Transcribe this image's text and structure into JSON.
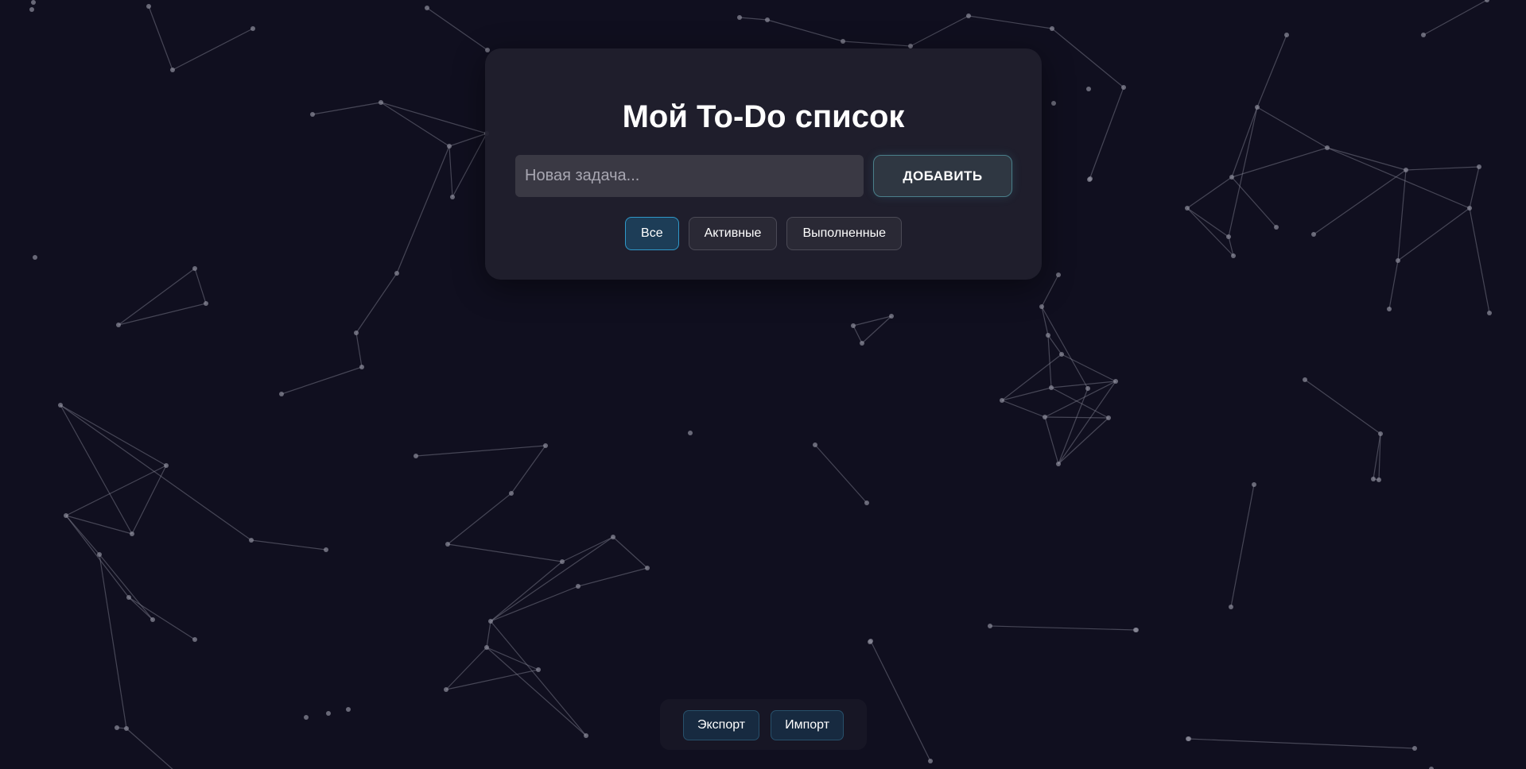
{
  "app": {
    "title": "Мой To-Do список"
  },
  "form": {
    "input_placeholder": "Новая задача...",
    "input_value": "",
    "add_label": "ДОБАВИТЬ"
  },
  "filters": {
    "all_label": "Все",
    "active_label": "Активные",
    "completed_label": "Выполненные",
    "selected": "all"
  },
  "footer": {
    "export_label": "Экспорт",
    "import_label": "Импорт"
  },
  "colors": {
    "background": "#100f1f",
    "card": "#201f2d",
    "accent": "#2f98c9",
    "network_line": "#8a8a98"
  }
}
